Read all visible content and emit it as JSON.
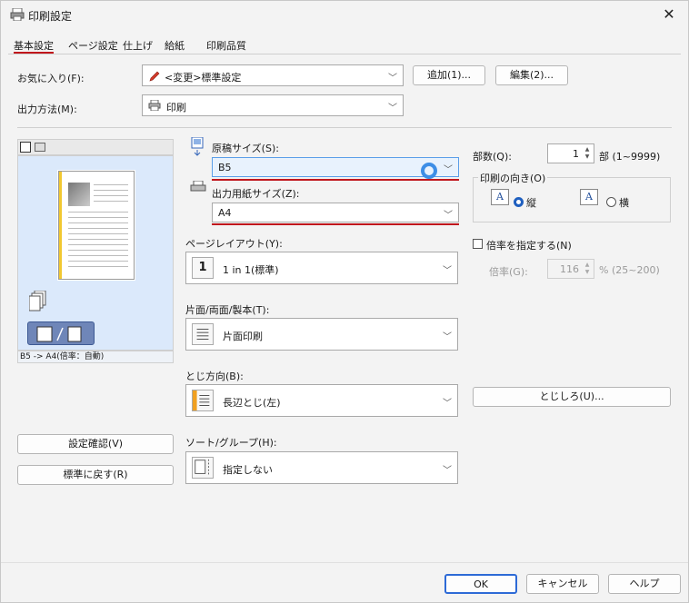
{
  "window": {
    "title": "印刷設定",
    "close": "✕"
  },
  "tabs": [
    "基本設定",
    "ページ設定",
    "仕上げ",
    "給紙",
    "印刷品質"
  ],
  "favorites": {
    "label": "お気に入り(F):",
    "value": "<変更>標準設定",
    "add": "追加(1)...",
    "edit": "編集(2)..."
  },
  "output": {
    "label": "出力方法(M):",
    "value": "印刷"
  },
  "preview": {
    "caption": "B5 -> A4(倍率：自動)"
  },
  "orig_size": {
    "label": "原稿サイズ(S):",
    "value": "B5"
  },
  "out_size": {
    "label": "出力用紙サイズ(Z):",
    "value": "A4"
  },
  "layout": {
    "label": "ページレイアウト(Y):",
    "value": "1 in 1(標準)",
    "icon_text": "1"
  },
  "duplex": {
    "label": "片面/両面/製本(T):",
    "value": "片面印刷"
  },
  "binding": {
    "label": "とじ方向(B):",
    "value": "長辺とじ(左)"
  },
  "sort": {
    "label": "ソート/グループ(H):",
    "value": "指定しない"
  },
  "copies": {
    "label": "部数(Q):",
    "value": "1",
    "unit": "部 (1~9999)"
  },
  "orientation": {
    "label": "印刷の向き(O)",
    "portrait": "縦",
    "landscape": "横",
    "icon": "A"
  },
  "scaling": {
    "check_label": "倍率を指定する(N)",
    "label": "倍率(G):",
    "value": "116",
    "unit": "% (25~200)"
  },
  "gutter": {
    "label": "とじしろ(U)..."
  },
  "confirm": {
    "label": "設定確認(V)"
  },
  "reset": {
    "label": "標準に戻す(R)"
  },
  "footer": {
    "ok": "OK",
    "cancel": "キャンセル",
    "help": "ヘルプ"
  }
}
